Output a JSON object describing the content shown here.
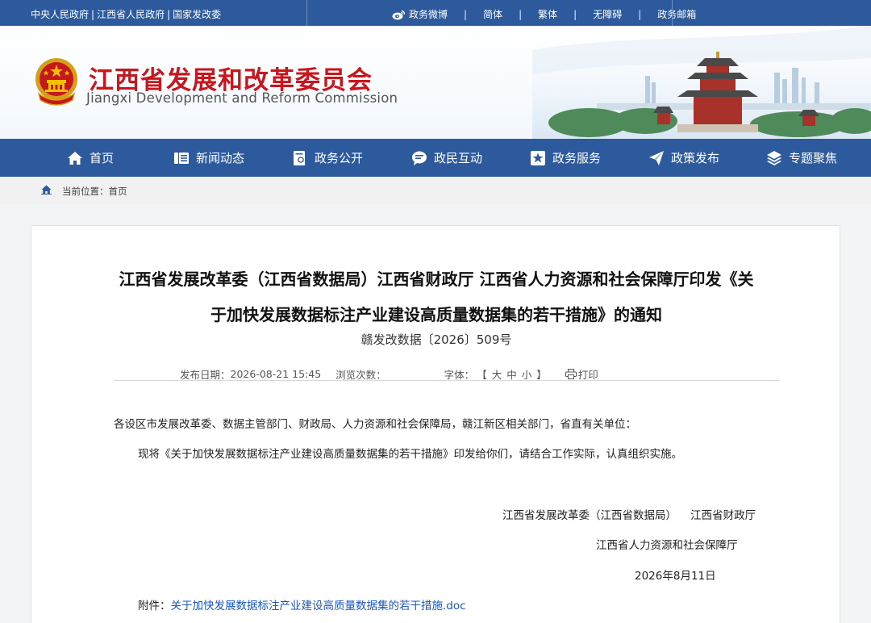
{
  "topbar": {
    "links": [
      "中央人民政府",
      "江西省人民政府",
      "国家发改委"
    ],
    "separator": "|",
    "weibo": "政务微博",
    "simplified": "简体",
    "traditional": "繁体",
    "accessibility": "无障碍",
    "mail": "政务邮箱"
  },
  "header": {
    "title_cn": "江西省发展和改革委员会",
    "title_en": "Jiangxi Development and Reform Commission"
  },
  "nav": {
    "items": [
      {
        "label": "首页",
        "icon": "home-icon"
      },
      {
        "label": "新闻动态",
        "icon": "news-icon"
      },
      {
        "label": "政务公开",
        "icon": "open-gov-icon"
      },
      {
        "label": "政民互动",
        "icon": "chat-icon"
      },
      {
        "label": "政务服务",
        "icon": "service-icon"
      },
      {
        "label": "政策发布",
        "icon": "send-icon"
      },
      {
        "label": "专题聚焦",
        "icon": "layers-icon"
      }
    ]
  },
  "breadcrumb": {
    "text": "当前位置：首页"
  },
  "article": {
    "title_line1": "江西省发展改革委（江西省数据局）江西省财政厅 江西省人力资源和社会保障厅印发《关",
    "title_line2": "于加快发展数据标注产业建设高质量数据集的若干措施》的通知",
    "doc_number": "赣发改数据〔2026〕509号",
    "publish_label": "发布日期：",
    "publish_date": "2026-08-21 15:45",
    "views_label": "浏览次数：",
    "font_label": "字体：",
    "font_open": "【",
    "font_large": "大",
    "font_medium": "中",
    "font_small": "小",
    "font_close": "】",
    "print_label": "打印",
    "addressee": "各设区市发展改革委、数据主管部门、财政局、人力资源和社会保障局，赣江新区相关部门，省直有关单位：",
    "body": "现将《关于加快发展数据标注产业建设高质量数据集的若干措施》印发给你们，请结合工作实际，认真组织实施。",
    "signature_line1": "江西省发展改革委（江西省数据局）    江西省财政厅",
    "signature_line2": "江西省人力资源和社会保障厅",
    "sign_date": "2026年8月11日",
    "attachment_label": "附件：",
    "attachment_link": "关于加快发展数据标注产业建设高质量数据集的若干措施.doc"
  },
  "colors": {
    "brand_blue": "#2d5a9c",
    "title_red": "#c8161d",
    "link_blue": "#1a57c0"
  }
}
